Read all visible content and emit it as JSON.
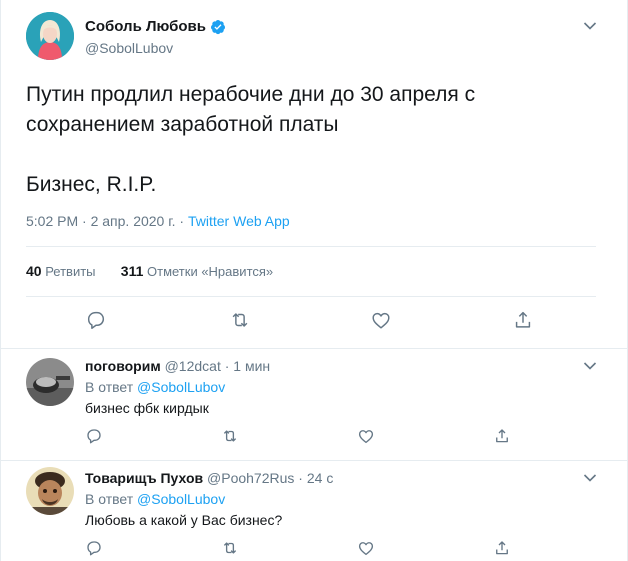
{
  "tweet": {
    "author": {
      "name": "Соболь Любовь",
      "handle": "@SobolLubov",
      "verified": true
    },
    "lines": [
      "Путин продлил нерабочие дни до 30 апреля с",
      "сохранением заработной платы",
      "Бизнес, R.I.P."
    ],
    "time": "5:02 PM",
    "date": "2 апр. 2020 г.",
    "separator": "·",
    "source": "Twitter Web App",
    "retweets_count": "40",
    "retweets_label": "Ретвиты",
    "likes_count": "311",
    "likes_label": "Отметки «Нравится»"
  },
  "replies": [
    {
      "name": "поговорим",
      "handle": "@12dcat",
      "time": "1 мин",
      "in_reply_label": "В ответ",
      "in_reply_to": "@SobolLubov",
      "text": "бизнес фбк кирдык"
    },
    {
      "name": "Товарищъ Пухов",
      "handle": "@Pooh72Rus",
      "time": "24 с",
      "in_reply_label": "В ответ",
      "in_reply_to": "@SobolLubov",
      "text": "Любовь а какой у Вас бизнес?"
    }
  ],
  "icons": {
    "reply": "reply-icon",
    "retweet": "retweet-icon",
    "like": "like-icon",
    "share": "share-icon",
    "more": "chevron-down-icon",
    "verified": "verified-badge-icon"
  },
  "colors": {
    "accent": "#1da1f2",
    "text": "#14171a",
    "secondary": "#657786",
    "border": "#e6ecf0"
  }
}
